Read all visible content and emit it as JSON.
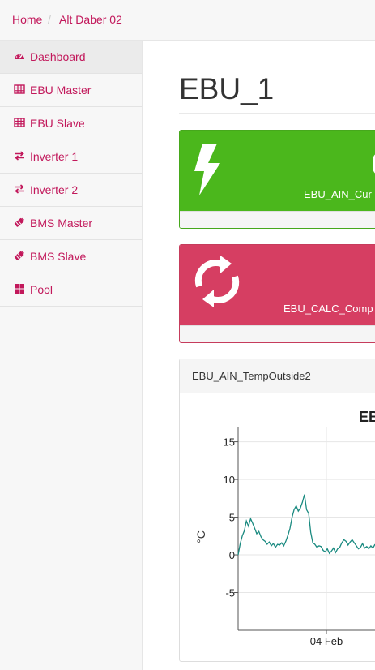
{
  "breadcrumb": {
    "home": "Home",
    "current": "Alt Daber 02"
  },
  "sidebar": {
    "items": [
      {
        "label": "Dashboard",
        "icon": "dashboard-icon",
        "active": true
      },
      {
        "label": "EBU Master",
        "icon": "table-icon"
      },
      {
        "label": "EBU Slave",
        "icon": "table-icon"
      },
      {
        "label": "Inverter 1",
        "icon": "exchange-icon"
      },
      {
        "label": "Inverter 2",
        "icon": "exchange-icon"
      },
      {
        "label": "BMS Master",
        "icon": "battery-icon"
      },
      {
        "label": "BMS Slave",
        "icon": "battery-icon"
      },
      {
        "label": "Pool",
        "icon": "grid-icon"
      }
    ]
  },
  "main": {
    "title": "EBU_1"
  },
  "cards": [
    {
      "label": "EBU_AIN_Cur",
      "icon": "bolt-icon",
      "color": "#4bb71c"
    },
    {
      "label": "EBU_CALC_Comp",
      "icon": "refresh-icon",
      "color": "#d63e62"
    }
  ],
  "panel": {
    "title": "EBU_AIN_TempOutside2"
  },
  "chart_data": {
    "type": "line",
    "title": "EB",
    "ylabel": "°C",
    "xlabel": "",
    "ylim": [
      -10,
      17
    ],
    "yticks": [
      15,
      10,
      5,
      0,
      -5
    ],
    "xtick_labels": [
      "04 Feb"
    ],
    "grid": true,
    "line_color": "#1a8a80",
    "series": [
      {
        "values": [
          [
            0,
            0
          ],
          [
            1,
            1.5
          ],
          [
            2,
            2.5
          ],
          [
            3,
            3.2
          ],
          [
            4,
            4.5
          ],
          [
            5,
            3.8
          ],
          [
            6,
            4.8
          ],
          [
            7,
            4.2
          ],
          [
            8,
            3.5
          ],
          [
            9,
            2.8
          ],
          [
            10,
            3.1
          ],
          [
            11,
            2.4
          ],
          [
            12,
            2.0
          ],
          [
            13,
            1.8
          ],
          [
            14,
            1.4
          ],
          [
            15,
            1.7
          ],
          [
            16,
            1.2
          ],
          [
            17,
            1.5
          ],
          [
            18,
            1.0
          ],
          [
            19,
            1.4
          ],
          [
            20,
            1.3
          ],
          [
            21,
            1.6
          ],
          [
            22,
            1.2
          ],
          [
            23,
            1.8
          ],
          [
            24,
            2.6
          ],
          [
            25,
            3.5
          ],
          [
            26,
            5.0
          ],
          [
            27,
            6.0
          ],
          [
            28,
            6.5
          ],
          [
            29,
            5.8
          ],
          [
            30,
            6.2
          ],
          [
            31,
            7.0
          ],
          [
            32,
            8.0
          ],
          [
            33,
            6.0
          ],
          [
            34,
            5.5
          ],
          [
            35,
            3.0
          ],
          [
            36,
            1.6
          ],
          [
            37,
            1.4
          ],
          [
            38,
            1.0
          ],
          [
            39,
            1.2
          ],
          [
            40,
            1.1
          ],
          [
            41,
            0.6
          ],
          [
            42,
            0.4
          ],
          [
            43,
            0.8
          ],
          [
            44,
            0.2
          ],
          [
            45,
            0.5
          ],
          [
            46,
            0.9
          ],
          [
            47,
            0.3
          ],
          [
            48,
            0.8
          ],
          [
            49,
            1.0
          ],
          [
            50,
            1.6
          ],
          [
            51,
            2.0
          ],
          [
            52,
            1.8
          ],
          [
            53,
            1.3
          ],
          [
            54,
            1.7
          ],
          [
            55,
            2.0
          ],
          [
            56,
            1.6
          ],
          [
            57,
            1.2
          ],
          [
            58,
            0.8
          ],
          [
            59,
            1.0
          ],
          [
            60,
            1.5
          ],
          [
            61,
            0.9
          ],
          [
            62,
            1.1
          ],
          [
            63,
            0.8
          ],
          [
            64,
            1.2
          ],
          [
            65,
            0.9
          ],
          [
            66,
            1.4
          ]
        ]
      }
    ]
  }
}
